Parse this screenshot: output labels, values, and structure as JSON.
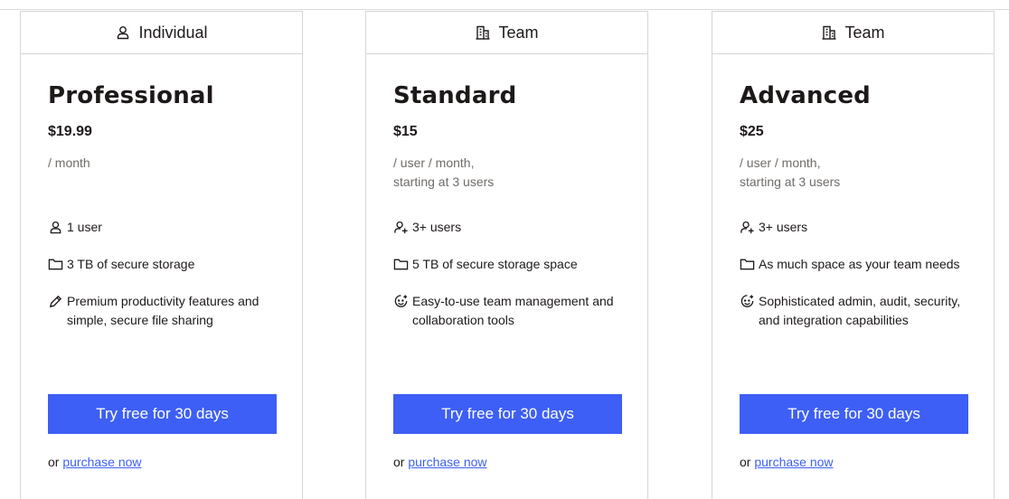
{
  "accent_color": "#3d5ff5",
  "cards": [
    {
      "category": "Individual",
      "category_icon": "person-icon",
      "name": "Professional",
      "price": "$19.99",
      "period_line1": "/ month",
      "period_line2": "",
      "features": [
        {
          "icon": "person-icon",
          "text": "1 user"
        },
        {
          "icon": "folder-icon",
          "text": "3 TB of secure storage"
        },
        {
          "icon": "pencil-icon",
          "text": "Premium productivity features and simple, secure file sharing"
        }
      ],
      "cta": "Try free for 30 days",
      "purchase_prefix": "or",
      "purchase_link": "purchase now"
    },
    {
      "category": "Team",
      "category_icon": "building-icon",
      "name": "Standard",
      "price": "$15",
      "period_line1": "/ user / month,",
      "period_line2": "starting at 3 users",
      "features": [
        {
          "icon": "person-plus-icon",
          "text": "3+ users"
        },
        {
          "icon": "folder-icon",
          "text": "5 TB of secure storage space"
        },
        {
          "icon": "smiley-icon",
          "text": "Easy-to-use team management and collaboration tools"
        }
      ],
      "cta": "Try free for 30 days",
      "purchase_prefix": "or",
      "purchase_link": "purchase now"
    },
    {
      "category": "Team",
      "category_icon": "building-icon",
      "name": "Advanced",
      "price": "$25",
      "period_line1": "/ user / month,",
      "period_line2": "starting at 3 users",
      "features": [
        {
          "icon": "person-plus-icon",
          "text": "3+ users"
        },
        {
          "icon": "folder-icon",
          "text": "As much space as your team needs"
        },
        {
          "icon": "smiley-icon",
          "text": "Sophisticated admin, audit, security, and integration capabilities"
        }
      ],
      "cta": "Try free for 30 days",
      "purchase_prefix": "or",
      "purchase_link": "purchase now"
    }
  ]
}
